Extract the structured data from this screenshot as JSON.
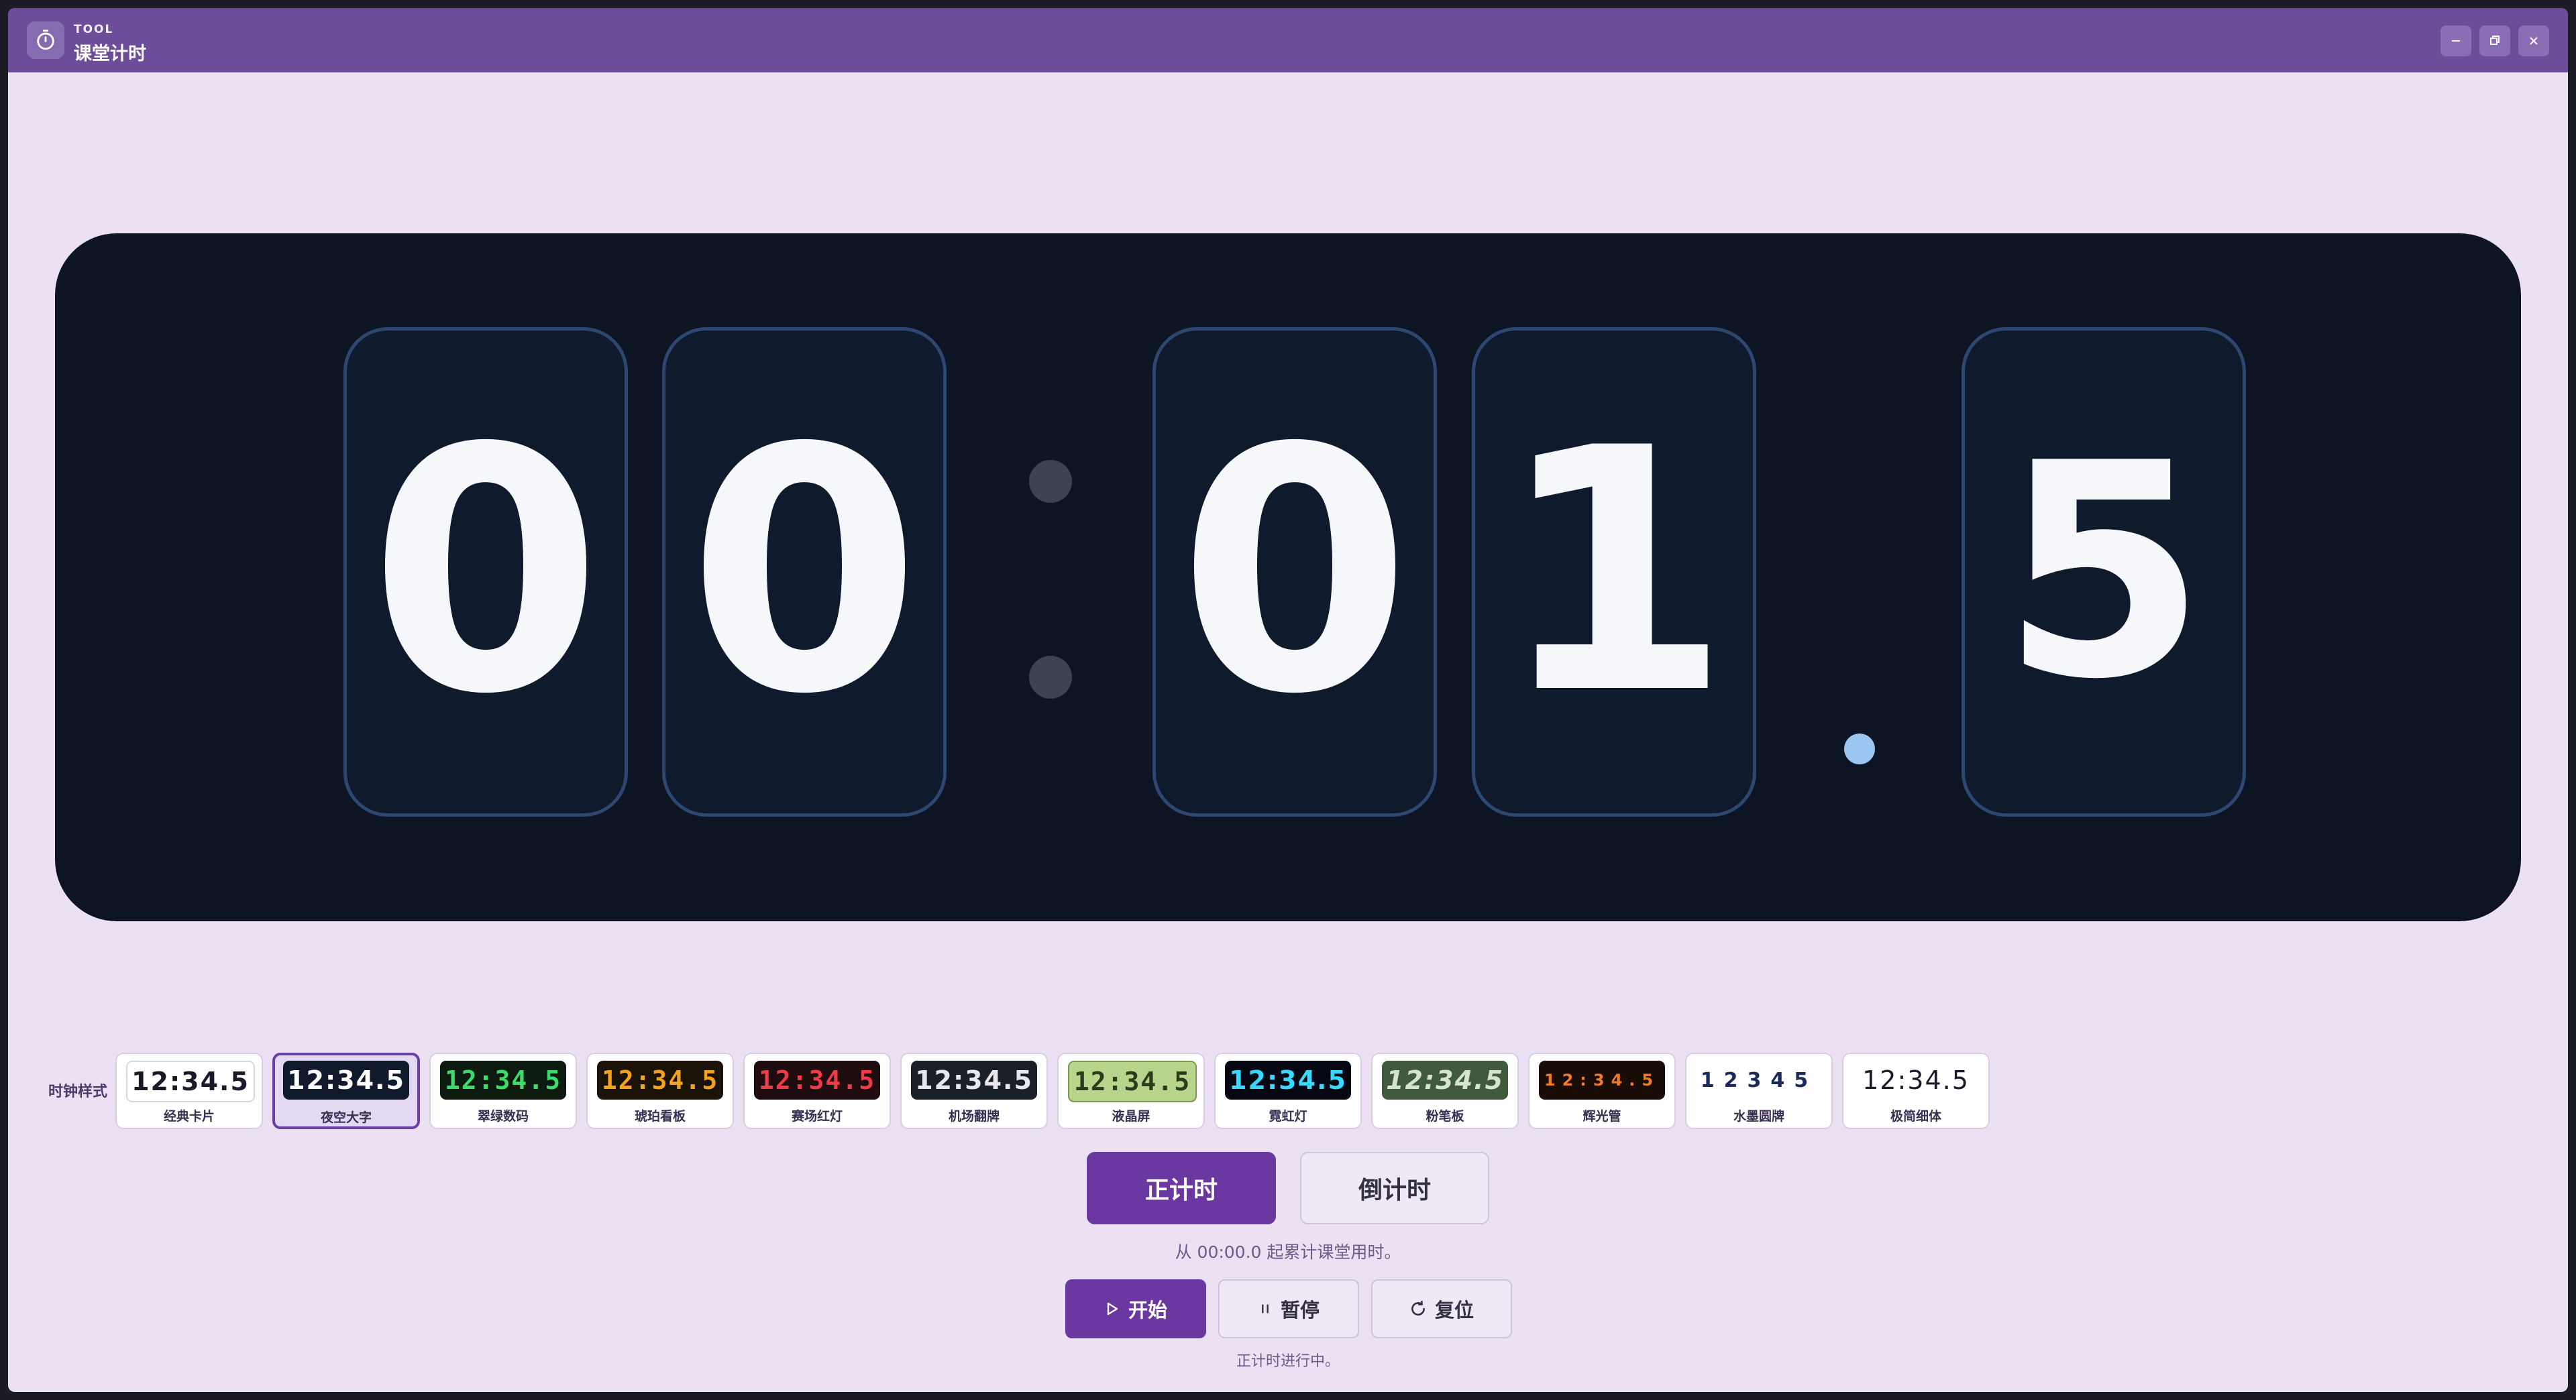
{
  "window": {
    "app_subtitle": "TOOL",
    "app_title": "课堂计时"
  },
  "display": {
    "digits": [
      "0",
      "0",
      "0",
      "1",
      "5"
    ]
  },
  "styles": {
    "label": "时钟样式",
    "selected_index": 1,
    "items": [
      {
        "name": "经典卡片",
        "preview": "12:34.5"
      },
      {
        "name": "夜空大字",
        "preview": "12:34.5"
      },
      {
        "name": "翠绿数码",
        "preview": "12:34.5"
      },
      {
        "name": "琥珀看板",
        "preview": "12:34.5"
      },
      {
        "name": "赛场红灯",
        "preview": "12:34.5"
      },
      {
        "name": "机场翻牌",
        "preview": "12:34.5"
      },
      {
        "name": "液晶屏",
        "preview": "12:34.5"
      },
      {
        "name": "霓虹灯",
        "preview": "12:34.5"
      },
      {
        "name": "粉笔板",
        "preview": "12:34.5"
      },
      {
        "name": "辉光管",
        "preview": "12:34.5"
      },
      {
        "name": "水墨圆牌",
        "preview": "12345"
      },
      {
        "name": "极简细体",
        "preview": "12:34.5"
      }
    ]
  },
  "modes": {
    "count_up_label": "正计时",
    "count_down_label": "倒计时",
    "active": "count_up",
    "hint": "从 00:00.0 起累计课堂用时。"
  },
  "controls": {
    "start_label": "开始",
    "pause_label": "暂停",
    "reset_label": "复位",
    "status": "正计时进行中。"
  },
  "colors": {
    "titlebar": "#6d4c9a",
    "accent": "#6a38a0",
    "background": "#ebe1f2",
    "display_bg": "#0d1524",
    "digit_border": "#2c4870",
    "decimal_dot": "#9cc6f2"
  },
  "icons": {
    "app": "stopwatch-icon",
    "minimize": "minimize-icon",
    "maximize": "restore-icon",
    "close": "close-icon",
    "start": "play-icon",
    "pause": "pause-icon",
    "reset": "reset-icon"
  }
}
